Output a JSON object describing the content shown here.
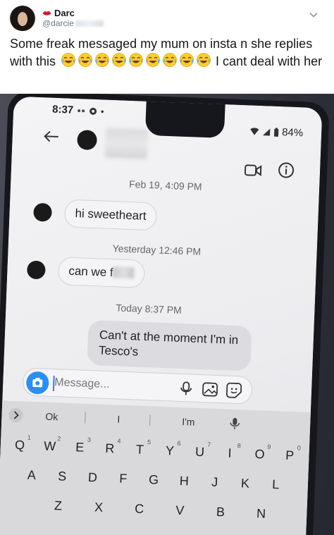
{
  "tweet": {
    "display_name": "Darc",
    "handle": "@darcie",
    "text_before": "Some freak messaged my mum on insta n she replies with this",
    "emoji_count": 9,
    "text_after": "I cant deal with her"
  },
  "phone": {
    "status_time": "8:37",
    "battery": "84%",
    "messages": [
      {
        "type": "timestamp",
        "text": "Feb 19, 4:09 PM"
      },
      {
        "type": "incoming",
        "text": "hi sweetheart"
      },
      {
        "type": "timestamp",
        "text": "Yesterday 12:46 PM"
      },
      {
        "type": "incoming",
        "text": "can we f"
      },
      {
        "type": "timestamp",
        "text": "Today 8:37 PM"
      },
      {
        "type": "outgoing",
        "line1": "Can't at the moment I'm in",
        "line2": "Tesco's"
      }
    ],
    "composer_placeholder": "Message...",
    "keyboard": {
      "suggestions": [
        "Ok",
        "I",
        "I'm"
      ],
      "row1": [
        "Q",
        "W",
        "E",
        "R",
        "T",
        "Y",
        "U",
        "I",
        "O",
        "P"
      ],
      "row1_hints": [
        "1",
        "2",
        "3",
        "4",
        "5",
        "6",
        "7",
        "8",
        "9",
        "0"
      ],
      "row2": [
        "A",
        "S",
        "D",
        "F",
        "G",
        "H",
        "J",
        "K",
        "L"
      ],
      "row3": [
        "Z",
        "X",
        "C",
        "V",
        "B",
        "N"
      ]
    }
  },
  "colors": {
    "accent_blue": "#2a8ff0",
    "text_primary": "#14171a",
    "text_secondary": "#657786"
  }
}
